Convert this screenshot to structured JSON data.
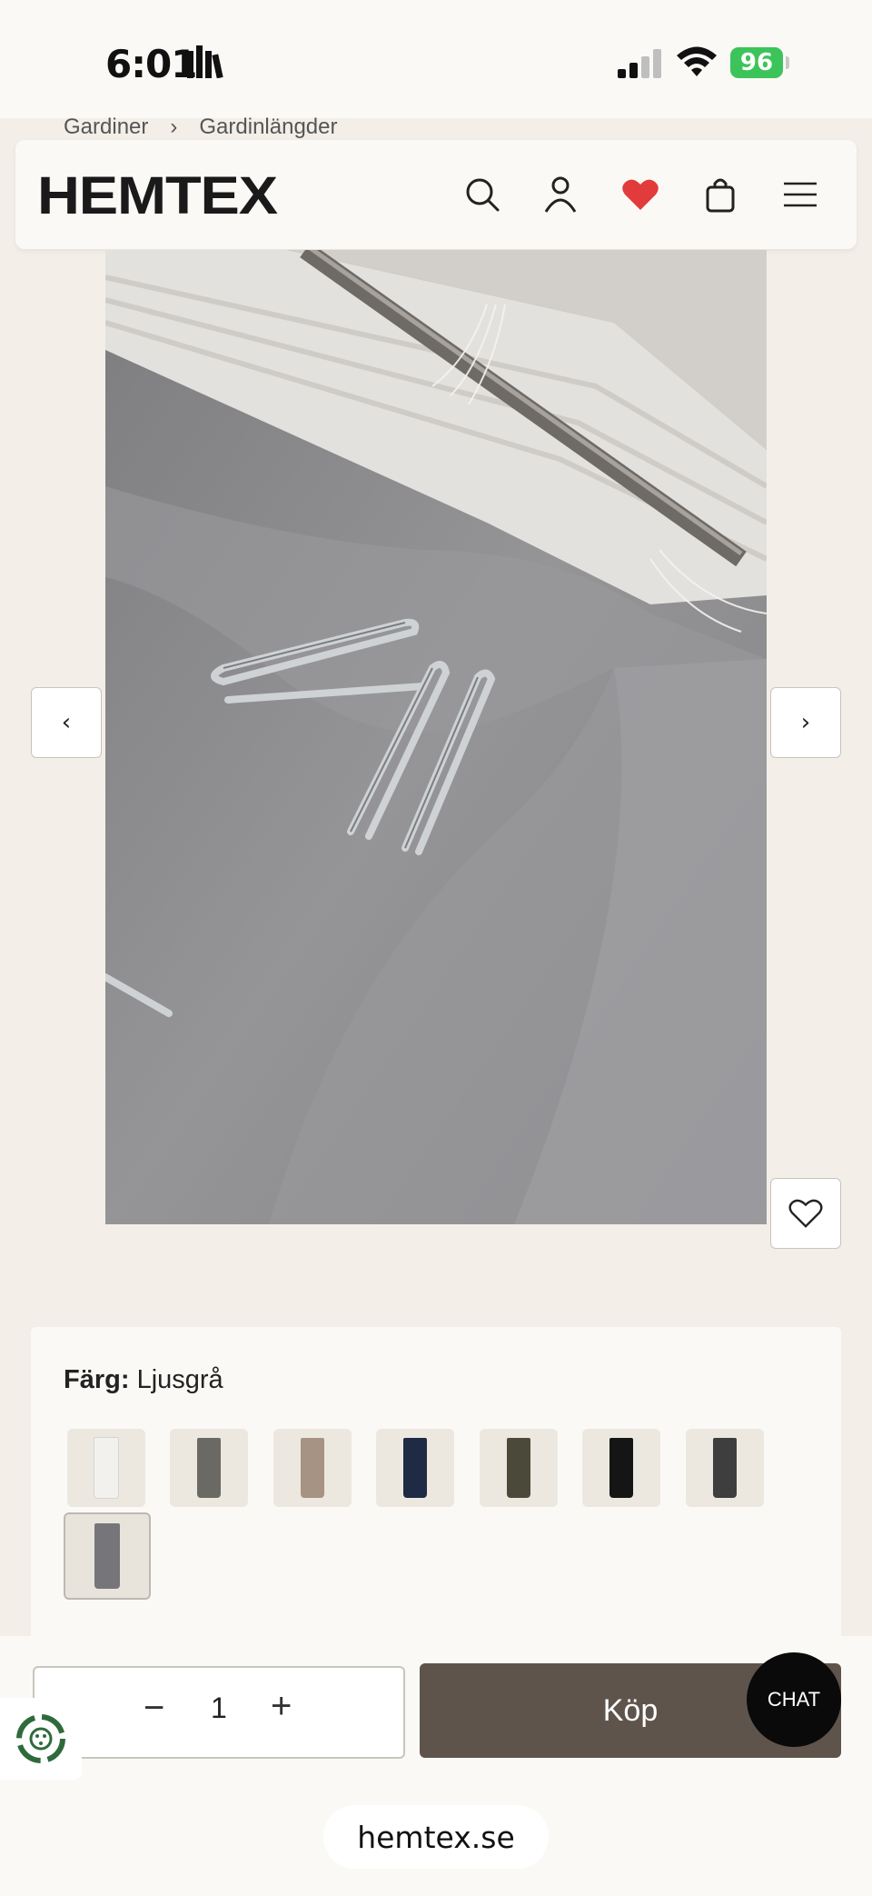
{
  "status_bar": {
    "time": "6:01",
    "battery": "96"
  },
  "breadcrumb": {
    "items": [
      "Gardiner",
      "Gardinlängder"
    ],
    "separator": "›"
  },
  "header": {
    "logo": "HEMTEX",
    "icons": [
      "search-icon",
      "account-icon",
      "heart-icon",
      "bag-icon",
      "menu-icon"
    ],
    "heart_color": "#e23b3b"
  },
  "gallery": {
    "prev_label": "‹",
    "next_label": "›"
  },
  "color": {
    "label": "Färg:",
    "value": "Ljusgrå",
    "swatches": [
      {
        "color": "#f2f1ee"
      },
      {
        "color": "#6b6964"
      },
      {
        "color": "#a79384"
      },
      {
        "color": "#1f2b44"
      },
      {
        "color": "#4b4a3a"
      },
      {
        "color": "#151515"
      },
      {
        "color": "#3e3e3e"
      },
      {
        "color": "#76767a",
        "selected": true
      }
    ]
  },
  "purchase": {
    "quantity": "1",
    "minus": "−",
    "plus": "+",
    "buy_label": "Köp",
    "chat_label": "CHAT"
  },
  "browser": {
    "url": "hemtex.se"
  }
}
